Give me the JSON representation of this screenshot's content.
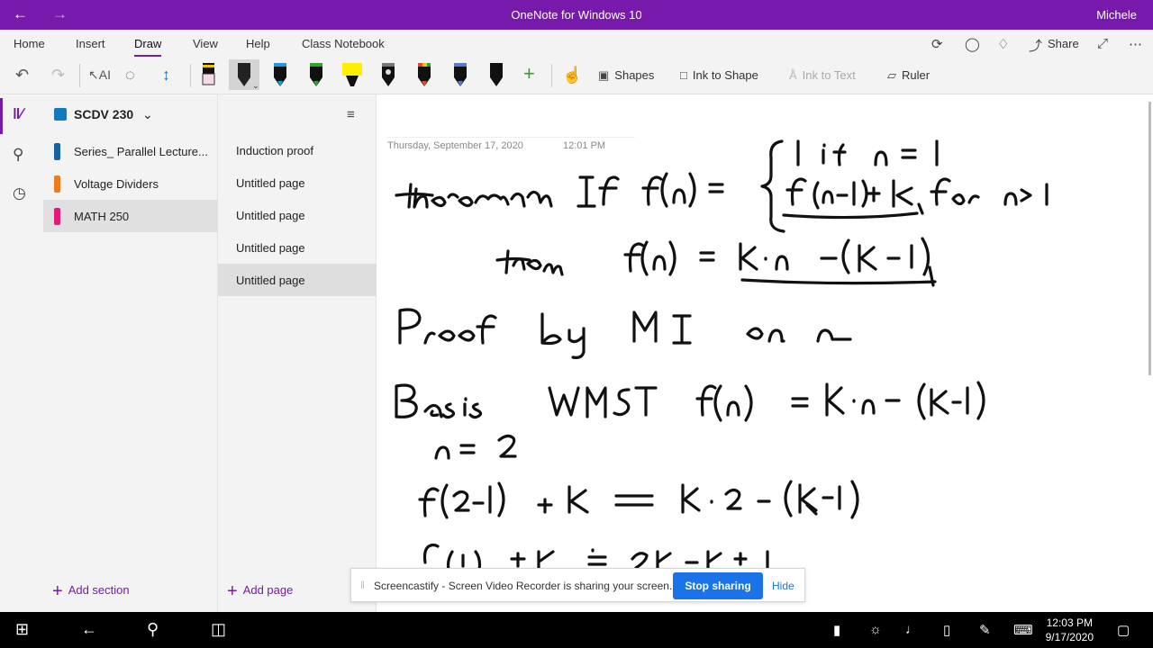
{
  "titlebar": {
    "back_icon": "back-arrow-icon",
    "forward_icon": "forward-arrow-icon",
    "title": "OneNote for Windows 10",
    "user": "Michele",
    "background": "#7719aa"
  },
  "ribbon": {
    "tabs": [
      "Home",
      "Insert",
      "Draw",
      "View",
      "Help",
      "Class Notebook"
    ],
    "active_tab": "Draw",
    "share_label": "Share"
  },
  "toolbar": {
    "pen_colors": [
      "#f4d9e8",
      "#222222",
      "#1b9be0",
      "#2fa52b",
      "#ffee00",
      "#777777",
      "#e44d26",
      "#5a7bd0",
      "#111111"
    ],
    "shapes_label": "Shapes",
    "ink_to_shape_label": "Ink to Shape",
    "ink_to_text_label": "Ink to Text",
    "ruler_label": "Ruler"
  },
  "notebook": {
    "name": "SCDV 230",
    "sections": [
      {
        "label": "Series_ Parallel Lecture...",
        "color": "#1464a5"
      },
      {
        "label": "Voltage Dividers",
        "color": "#f07b1c"
      },
      {
        "label": "MATH 250",
        "color": "#e3197e"
      }
    ],
    "selected_section": 2,
    "add_section_label": "Add section"
  },
  "pages": {
    "items": [
      "Induction proof",
      "Untitled page",
      "Untitled page",
      "Untitled page",
      "Untitled page"
    ],
    "selected": 4,
    "add_page_label": "Add page"
  },
  "page": {
    "date": "Thursday, September 17, 2020",
    "time": "12:01 PM"
  },
  "sharebar": {
    "message": "Screencastify - Screen Video Recorder is sharing your screen.",
    "stop_label": "Stop sharing",
    "hide_label": "Hide"
  },
  "taskbar": {
    "time": "12:03 PM",
    "date": "9/17/2020"
  }
}
